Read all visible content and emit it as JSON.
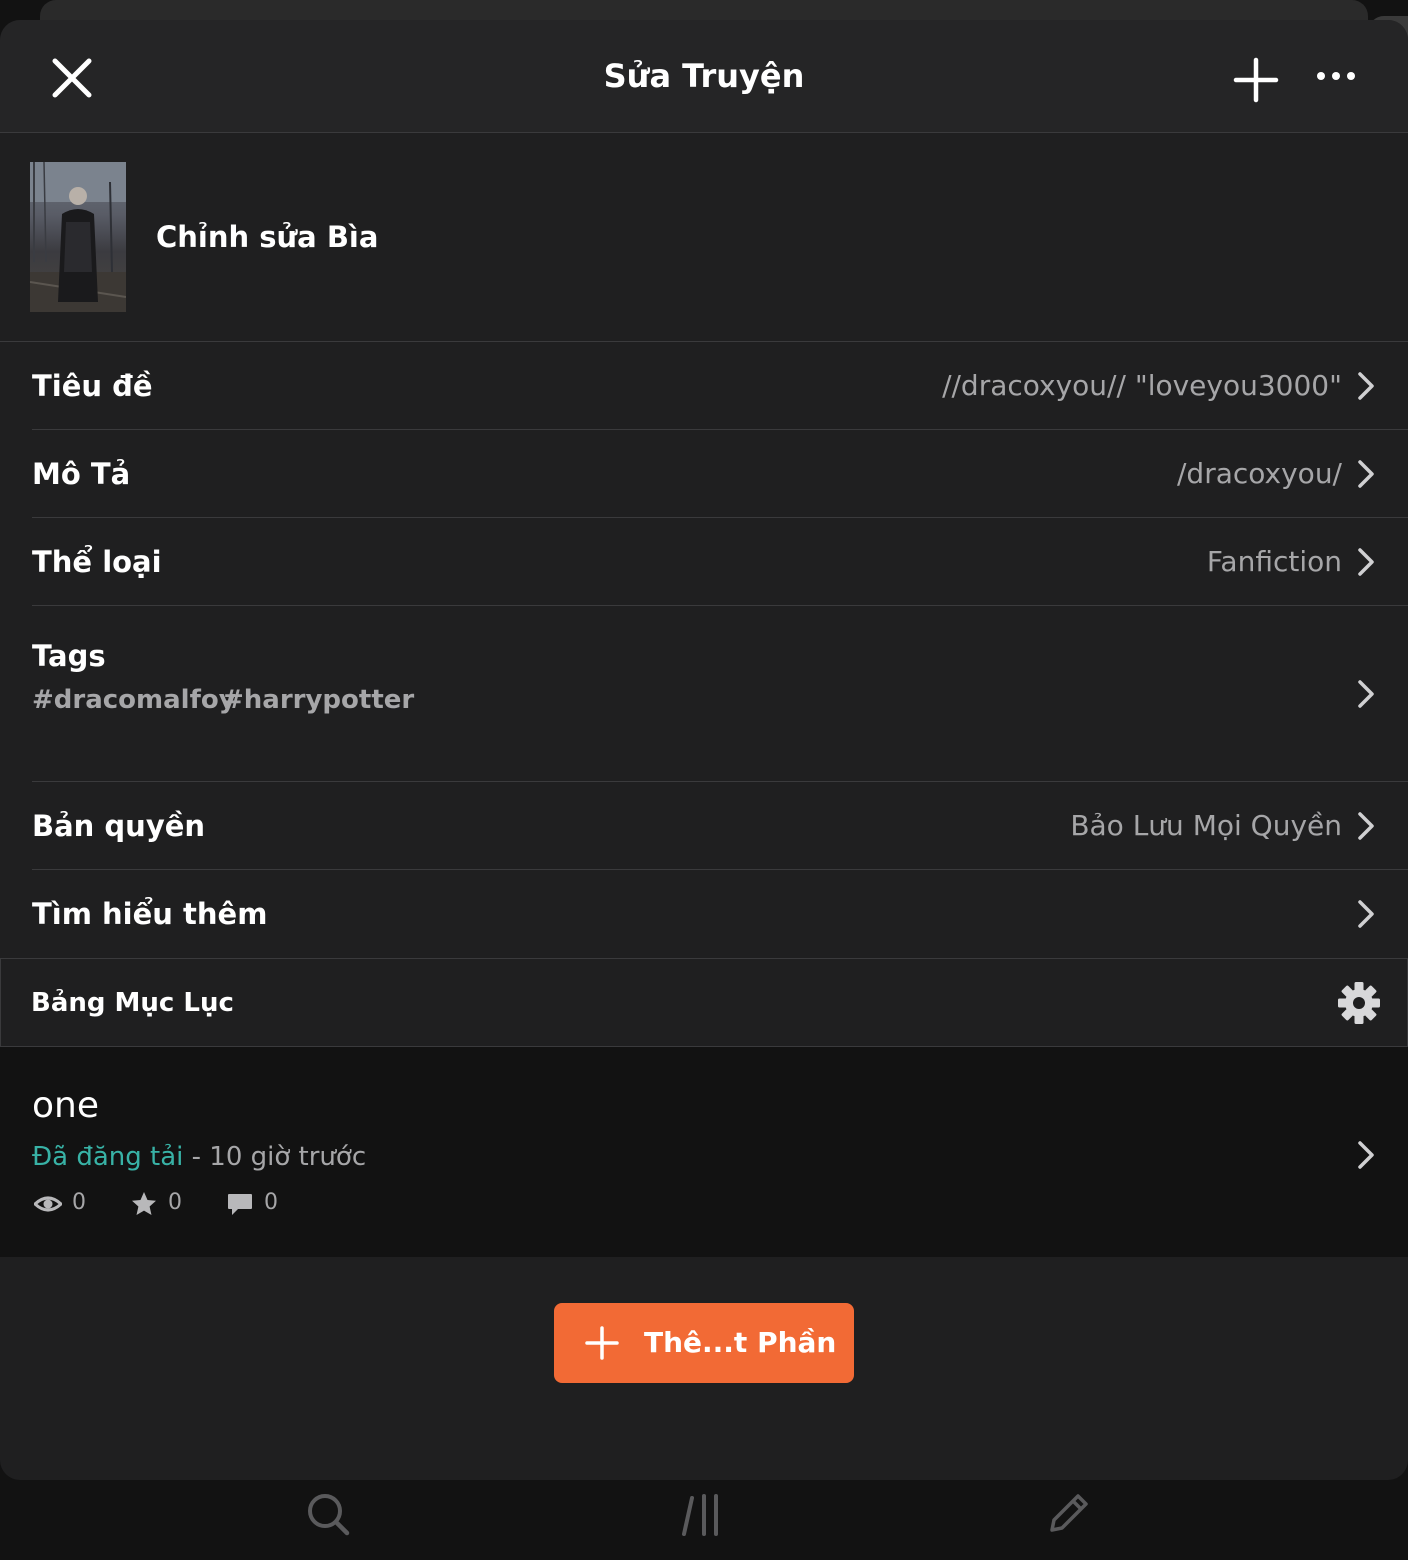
{
  "header": {
    "title": "Sửa Truyện",
    "close_icon": "close-icon",
    "add_icon": "plus-icon",
    "more_icon": "more-horizontal-icon"
  },
  "cover": {
    "label": "Chỉnh sửa Bìa"
  },
  "fields": {
    "title": {
      "label": "Tiêu đề",
      "value": "//dracoxyou// \"loveyou3000\""
    },
    "description": {
      "label": "Mô Tả",
      "value": "/dracoxyou/"
    },
    "category": {
      "label": "Thể loại",
      "value": "Fanfiction"
    },
    "tags": {
      "label": "Tags",
      "items": [
        "#dracomalfoy",
        "#harrypotter"
      ]
    },
    "copyright": {
      "label": "Bản quyền",
      "value": "Bảo Lưu Mọi Quyền"
    },
    "learn_more": {
      "label": "Tìm hiểu thêm"
    }
  },
  "toc": {
    "label": "Bảng Mục Lục",
    "settings_icon": "gear-icon"
  },
  "part": {
    "title": "one",
    "status": "Đã đăng tải",
    "time": " - 10 giờ trước",
    "views": "0",
    "votes": "0",
    "comments": "0"
  },
  "add_part": {
    "label": "Thê...t Phần"
  },
  "bottom_nav": {
    "icons": [
      "search-icon",
      "library-icon",
      "pencil-icon"
    ]
  },
  "colors": {
    "accent": "#f26a35",
    "published": "#38b2a6",
    "background": "#1f1f20",
    "muted_text": "#a6a6a8"
  }
}
